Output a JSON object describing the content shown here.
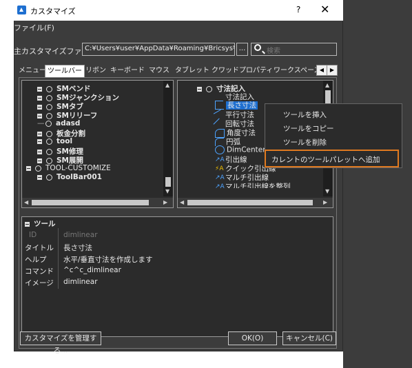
{
  "window": {
    "title": "カスタマイズ",
    "help_glyph": "?",
    "close_glyph": "✕",
    "accent": "#1e6fd0"
  },
  "menu": {
    "file": "ファイル(F)"
  },
  "main_file": {
    "label": "主カスタマイズファイル:",
    "path": "C:¥Users¥user¥AppData¥Roaming¥Bricsys¥B",
    "browse": "...",
    "search_placeholder": "検索"
  },
  "tabs": [
    {
      "label": "メニュー"
    },
    {
      "label": "ツールバー",
      "active": true
    },
    {
      "label": "リボン"
    },
    {
      "label": "キーボード"
    },
    {
      "label": "マウス"
    },
    {
      "label": "タブレット"
    },
    {
      "label": "クワッド"
    },
    {
      "label": "プロパティ"
    },
    {
      "label": "ワークスペース"
    }
  ],
  "tab_arrows": {
    "left": "◀",
    "right": "▶"
  },
  "left_tree": [
    {
      "label": "SMベンド",
      "bold": true
    },
    {
      "label": "SMジャンクション",
      "bold": true
    },
    {
      "label": "SMタブ",
      "bold": true
    },
    {
      "label": "SMリリーフ",
      "bold": true
    },
    {
      "label": "adasd",
      "bold": true
    },
    {
      "label": "板金分割",
      "bold": true
    },
    {
      "label": "tool",
      "bold": true
    },
    {
      "label": "SM修理",
      "bold": true
    },
    {
      "label": "SM展開",
      "bold": true
    },
    {
      "label": "TOOL-CUSTOMIZE",
      "bold": false
    },
    {
      "label": "ToolBar001",
      "bold": true
    }
  ],
  "right_tree": {
    "root": "寸法記入",
    "items": [
      {
        "label": "寸法記入"
      },
      {
        "label": "長さ寸法",
        "selected": true
      },
      {
        "label": "平行寸法"
      },
      {
        "label": "回転寸法"
      },
      {
        "label": "角度寸法"
      },
      {
        "label": "円弧"
      },
      {
        "label": "DimCenter"
      },
      {
        "label": "引出線"
      },
      {
        "label": "クイック引出線"
      },
      {
        "label": "マルチ引出線"
      },
      {
        "label": "マルチ引出線を整列"
      }
    ]
  },
  "context_menu": {
    "insert": "ツールを挿入",
    "copy": "ツールをコピー",
    "delete": "ツールを削除",
    "add_to_palette": "カレントのツールパレットへ追加",
    "highlight_color": "#e07a20"
  },
  "properties": {
    "header": "ツール",
    "rows": [
      {
        "key": "ID",
        "value": "dimlinear",
        "disabled": true
      },
      {
        "key": "タイトル",
        "value": "長さ寸法"
      },
      {
        "key": "ヘルプ",
        "value": "水平/垂直寸法を作成します"
      },
      {
        "key": "コマンド",
        "value": "^c^c_dimlinear"
      },
      {
        "key": "イメージ",
        "value": "dimlinear"
      }
    ]
  },
  "buttons": {
    "manage": "カスタマイズを管理する...",
    "ok": "OK(O)",
    "cancel": "キャンセル(C)"
  },
  "colors": {
    "dialog_bg": "#3c3c3c",
    "panel_bg": "#2b2b2b",
    "selection": "#1e6fd0"
  }
}
